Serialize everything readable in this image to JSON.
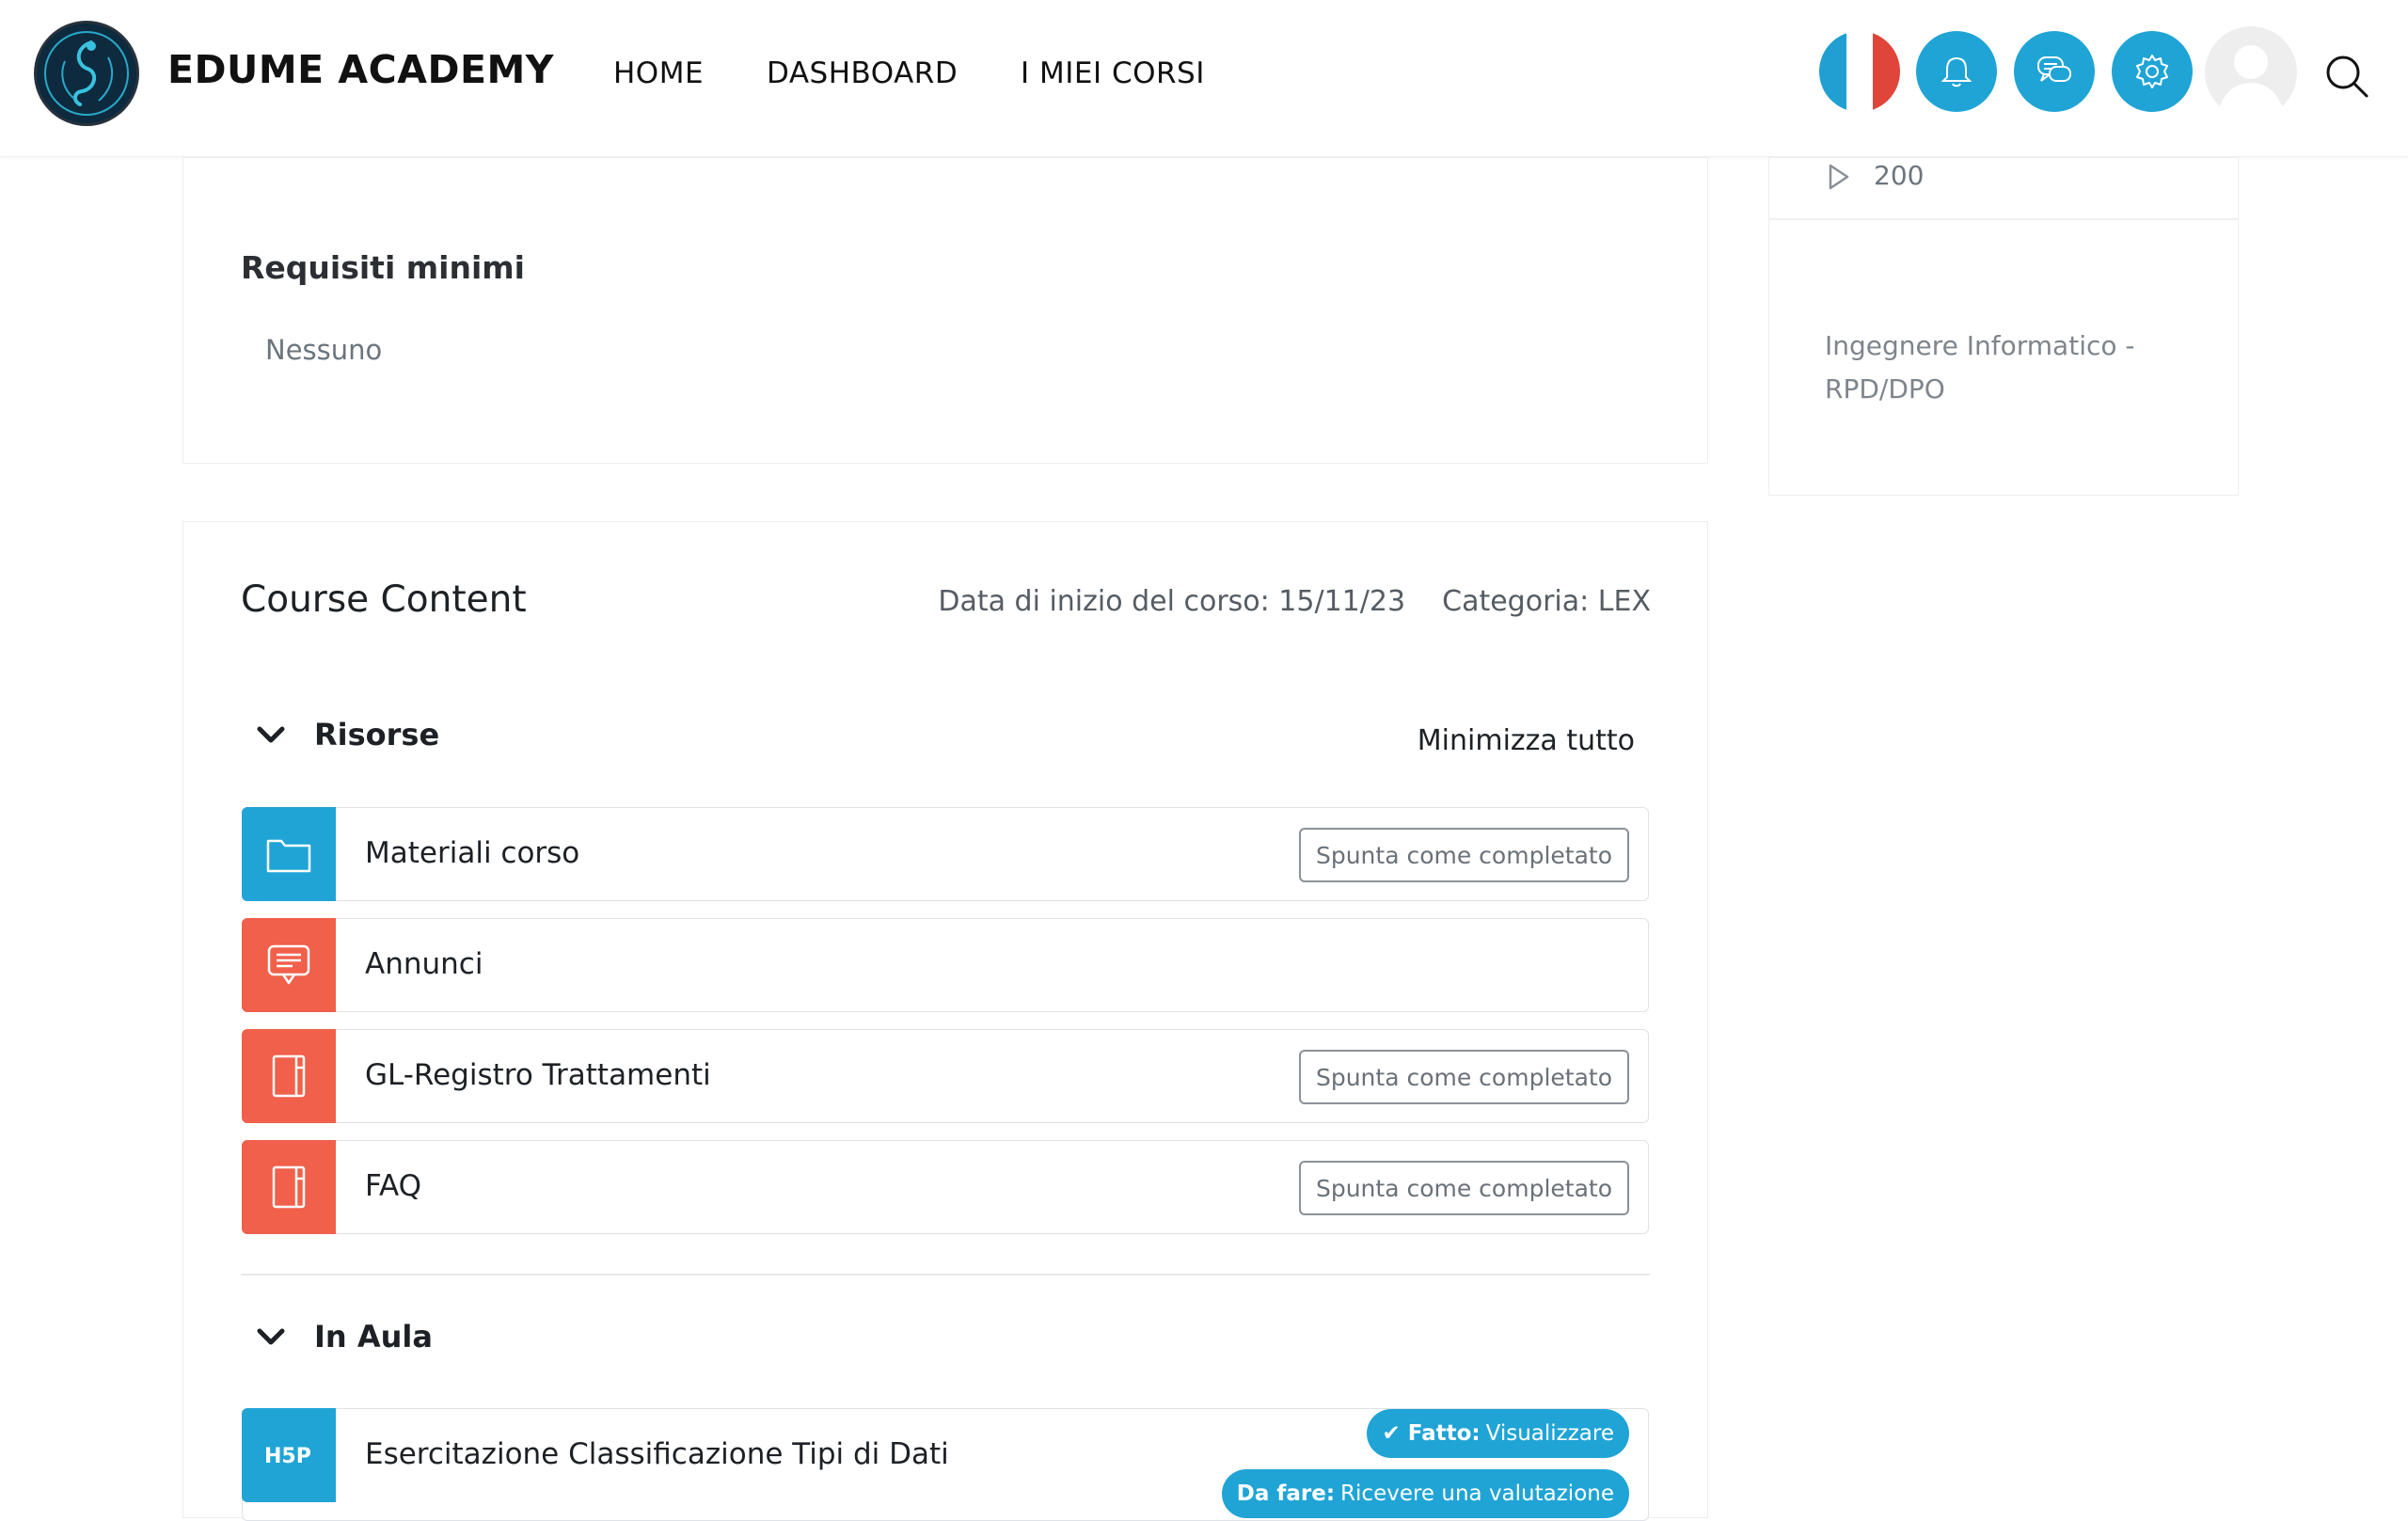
{
  "header": {
    "brand": "EDUME ACADEMY",
    "nav": [
      "HOME",
      "DASHBOARD",
      "I MIEI CORSI"
    ],
    "accent": "#20a4d6"
  },
  "sidebar": {
    "count": "200",
    "teacher_role": "Ingegnere Informatico - RPD/DPO"
  },
  "requirements": {
    "title": "Requisiti minimi",
    "value": "Nessuno"
  },
  "course_content": {
    "title": "Course Content",
    "start_date": "Data di inizio del corso: 15/11/23",
    "category": "Categoria: LEX",
    "collapse_all": "Minimizza tutto",
    "sections": [
      {
        "title": "Risorse",
        "activities": [
          {
            "name": "Materiali corso",
            "icon": "folder-icon",
            "color": "#20a4d6",
            "mark": "Spunta come completato"
          },
          {
            "name": "Annunci",
            "icon": "forum-icon",
            "color": "#f0604a",
            "mark": ""
          },
          {
            "name": "GL-Registro Trattamenti",
            "icon": "book-icon",
            "color": "#f0604a",
            "mark": "Spunta come completato"
          },
          {
            "name": "FAQ",
            "icon": "book-icon",
            "color": "#f0604a",
            "mark": "Spunta come completato"
          }
        ]
      },
      {
        "title": "In Aula",
        "activities": [
          {
            "name": "Esercitazione Classificazione Tipi di Dati",
            "icon": "h5p-icon",
            "color": "#20a4d6",
            "done_label": "Fatto:",
            "done_value": "Visualizzare",
            "todo_label": "Da fare:",
            "todo_value": "Ricevere una valutazione"
          }
        ]
      }
    ]
  }
}
